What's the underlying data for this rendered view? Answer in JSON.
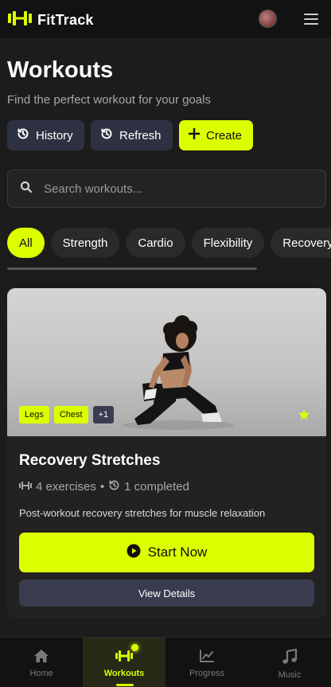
{
  "app": {
    "name": "FitTrack"
  },
  "header": {
    "title": "Workouts",
    "subtitle": "Find the perfect workout for your goals"
  },
  "actions": {
    "history_label": "History",
    "refresh_label": "Refresh",
    "create_label": "Create"
  },
  "search": {
    "placeholder": "Search workouts..."
  },
  "filters": [
    "All",
    "Strength",
    "Cardio",
    "Flexibility",
    "Recovery"
  ],
  "active_filter": "All",
  "workout_card": {
    "title": "Recovery Stretches",
    "tags": [
      "Legs",
      "Chest"
    ],
    "more_tags": "+1",
    "exercises": "4 exercises",
    "completed": "1 completed",
    "description": "Post-workout recovery stretches for muscle relaxation",
    "start_label": "Start Now",
    "details_label": "View Details",
    "favorited": true
  },
  "bottom_nav": {
    "home": "Home",
    "workouts": "Workouts",
    "progress": "Progress",
    "music": "Music",
    "active": "Workouts"
  },
  "colors": {
    "accent": "#dcff00",
    "background": "#1c1c1c",
    "card": "#222222",
    "secondary_button": "#2e3142"
  }
}
